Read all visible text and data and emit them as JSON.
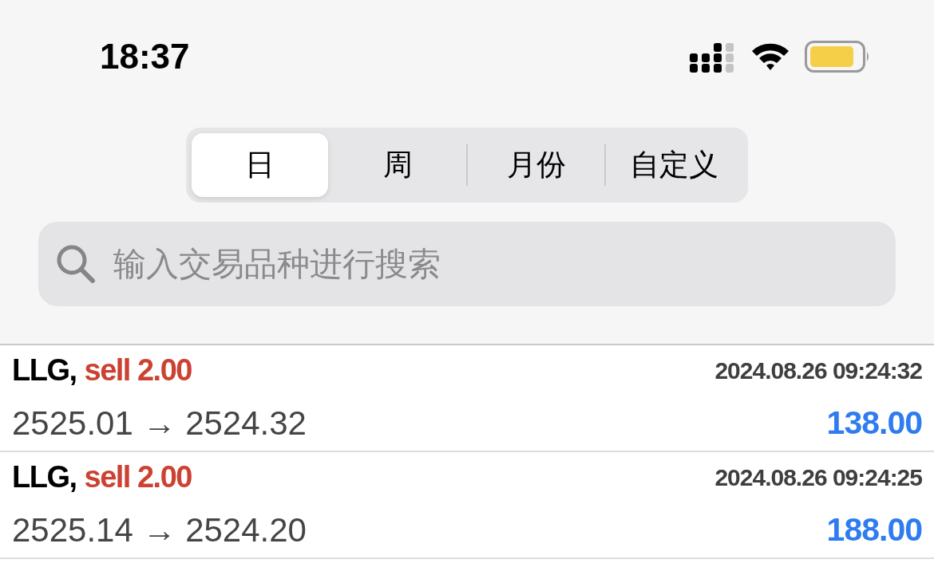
{
  "status_bar": {
    "time": "18:37"
  },
  "tabs": [
    {
      "label": "日",
      "selected": true
    },
    {
      "label": "周",
      "selected": false
    },
    {
      "label": "月份",
      "selected": false
    },
    {
      "label": "自定义",
      "selected": false
    }
  ],
  "search": {
    "placeholder": "输入交易品种进行搜索"
  },
  "trades": [
    {
      "symbol": "LLG,",
      "side": "sell 2.00",
      "time": "2024.08.26 09:24:32",
      "prices": "2525.01 → 2524.32",
      "profit": "138.00"
    },
    {
      "symbol": "LLG,",
      "side": "sell 2.00",
      "time": "2024.08.26 09:24:25",
      "prices": "2525.14 → 2524.20",
      "profit": "188.00"
    }
  ]
}
